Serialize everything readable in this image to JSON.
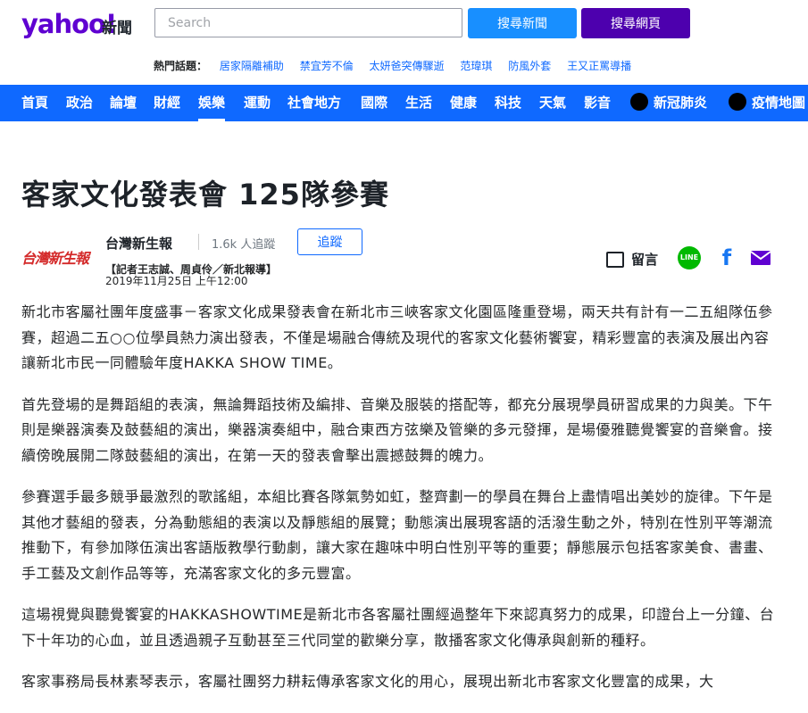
{
  "header": {
    "logo": "yahoo!",
    "logo_sub": "新聞",
    "search_placeholder": "Search",
    "search_news_label": "搜尋新聞",
    "search_web_label": "搜尋網頁"
  },
  "hot_topics": {
    "label": "熱門話題：",
    "items": [
      "居家隔離補助",
      "禁宜芳不倫",
      "太妍爸突傳驟逝",
      "范瑋琪",
      "防風外套",
      "王又正罵導播"
    ]
  },
  "nav": {
    "items": [
      "首頁",
      "政治",
      "論壇",
      "財經",
      "娛樂",
      "運動",
      "社會地方",
      "國際",
      "生活",
      "健康",
      "科技",
      "天氣",
      "影音",
      "新冠肺炎",
      "疫情地圖"
    ],
    "active": "娛樂"
  },
  "article": {
    "title": "客家文化發表會 125隊參賽",
    "publisher_logo": "台灣新生報",
    "publisher": "台灣新生報",
    "followers": "1.6k 人追蹤",
    "follow_label": "追蹤",
    "author": "【記者王志誠、周貞伶／新北報導】",
    "date": "2019年11月25日 上午12:00",
    "comment_label": "留言",
    "share_line": "LINE",
    "paragraphs": [
      "新北市客屬社團年度盛事－客家文化成果發表會在新北市三峽客家文化園區隆重登場，兩天共有計有一二五組隊伍參賽，超過二五○○位學員熱力演出發表，不僅是場融合傳統及現代的客家文化藝術饗宴，精彩豐富的表演及展出內容讓新北市民一同體驗年度HAKKA SHOW TIME。",
      "首先登場的是舞蹈組的表演，無論舞蹈技術及編排、音樂及服裝的搭配等，都充分展現學員研習成果的力與美。下午則是樂器演奏及鼓藝組的演出，樂器演奏組中，融合東西方弦樂及管樂的多元發揮，是場優雅聽覺饗宴的音樂會。接續傍晚展開二隊鼓藝組的演出，在第一天的發表會擊出震撼鼓舞的魄力。",
      "參賽選手最多競爭最激烈的歌謠組，本組比賽各隊氣勢如虹，整齊劃一的學員在舞台上盡情唱出美妙的旋律。下午是其他才藝組的發表，分為動態組的表演以及靜態組的展覽；動態演出展現客語的活潑生動之外，特別在性別平等潮流推動下，有參加隊伍演出客語版教學行動劇，讓大家在趣味中明白性別平等的重要；靜態展示包括客家美食、書畫、手工藝及文創作品等等，充滿客家文化的多元豐富。",
      "這場視覺與聽覺饗宴的HAKKASHOWTIME是新北市各客屬社團經過整年下來認真努力的成果，印證台上一分鐘、台下十年功的心血，並且透過親子互動甚至三代同堂的歡樂分享，散播客家文化傳承與創新的種籽。",
      "客家事務局長林素琴表示，客屬社團努力耕耘傳承客家文化的用心，展現出新北市客家文化豐富的成果，大"
    ]
  },
  "colors": {
    "brand_purple": "#5f01d1",
    "nav_blue": "#0f69ff",
    "search_news_blue": "#188fff",
    "search_web_purple": "#4d00ae",
    "line_green": "#00b900",
    "facebook_blue": "#1877f2",
    "mail_purple": "#5f01d1"
  },
  "icons": {
    "comment": "comment-icon",
    "line": "line-icon",
    "facebook": "facebook-icon",
    "mail": "mail-icon",
    "covid": "virus-icon",
    "map": "globe-icon"
  }
}
